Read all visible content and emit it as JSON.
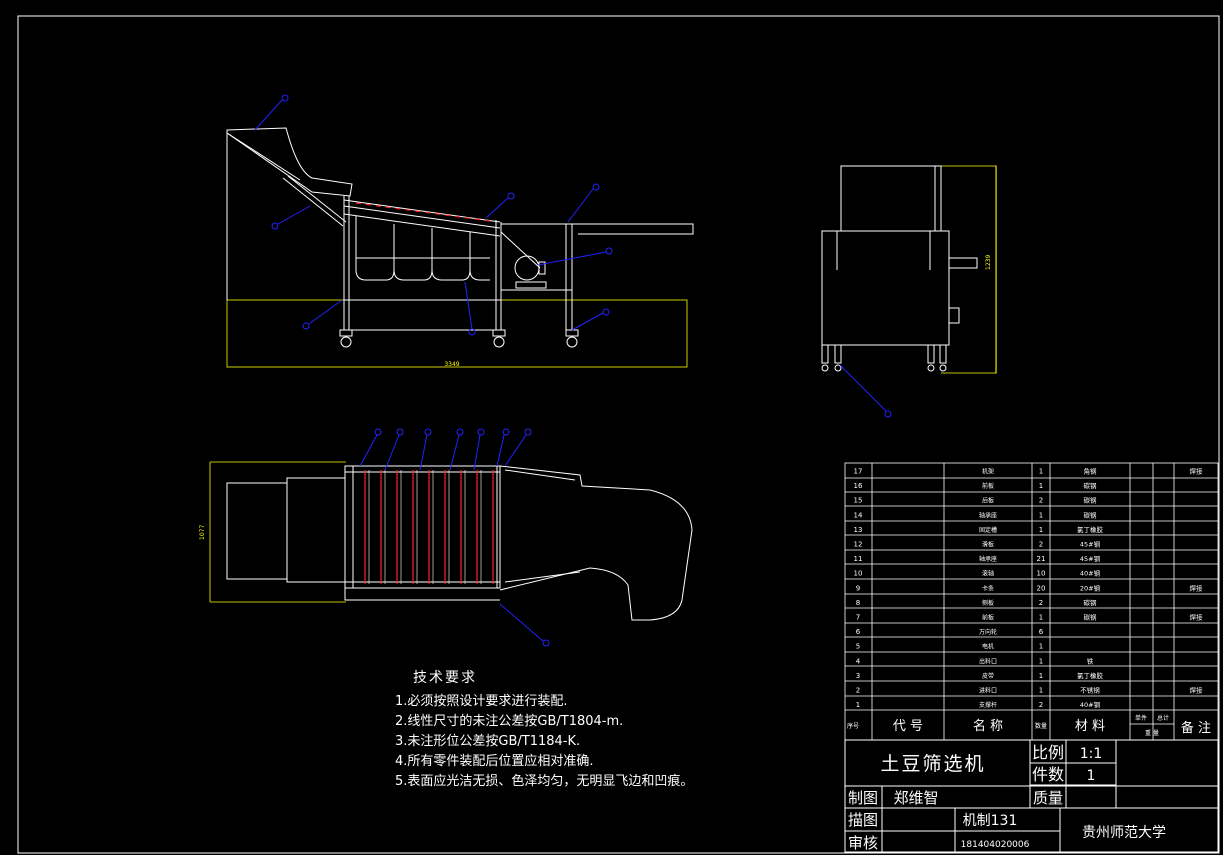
{
  "drawing": {
    "colors": {
      "background": "#000000",
      "line": "#ffffff",
      "balloon": "#2222ff",
      "screen_rod": "#ff2020",
      "dimension": "#ffff00"
    },
    "dimensions": {
      "side_length": "3349",
      "top_width": "1077",
      "end_height": "1239"
    }
  },
  "notes": {
    "title": "技术要求",
    "items": [
      "1.必须按照设计要求进行装配.",
      "2.线性尺寸的未注公差按GB/T1804-m.",
      "3.未注形位公差按GB/T1184-K.",
      "4.所有零件装配后位置应相对准确.",
      "5.表面应光洁无损、色泽均匀，无明显飞边和凹痕。"
    ]
  },
  "bom": {
    "rows": [
      {
        "no": "17",
        "name": "机架",
        "qty": "1",
        "material": "角钢",
        "note": "焊接"
      },
      {
        "no": "16",
        "name": "前板",
        "qty": "1",
        "material": "碳钢",
        "note": ""
      },
      {
        "no": "15",
        "name": "后板",
        "qty": "2",
        "material": "碳钢",
        "note": ""
      },
      {
        "no": "14",
        "name": "轴承座",
        "qty": "1",
        "material": "碳钢",
        "note": ""
      },
      {
        "no": "13",
        "name": "固定槽",
        "qty": "1",
        "material": "氯丁橡胶",
        "note": ""
      },
      {
        "no": "12",
        "name": "滑板",
        "qty": "2",
        "material": "45#钢",
        "note": ""
      },
      {
        "no": "11",
        "name": "轴承座",
        "qty": "21",
        "material": "45#钢",
        "note": ""
      },
      {
        "no": "10",
        "name": "滚轴",
        "qty": "10",
        "material": "40#钢",
        "note": ""
      },
      {
        "no": "9",
        "name": "卡条",
        "qty": "20",
        "material": "20#钢",
        "note": "焊接"
      },
      {
        "no": "8",
        "name": "侧板",
        "qty": "2",
        "material": "碳钢",
        "note": ""
      },
      {
        "no": "7",
        "name": "前板",
        "qty": "1",
        "material": "碳钢",
        "note": "焊接"
      },
      {
        "no": "6",
        "name": "万向轮",
        "qty": "6",
        "material": "",
        "note": ""
      },
      {
        "no": "5",
        "name": "电机",
        "qty": "1",
        "material": "",
        "note": ""
      },
      {
        "no": "4",
        "name": "出料口",
        "qty": "1",
        "material": "铁",
        "note": ""
      },
      {
        "no": "3",
        "name": "皮带",
        "qty": "1",
        "material": "氯丁橡胶",
        "note": ""
      },
      {
        "no": "2",
        "name": "进料口",
        "qty": "1",
        "material": "不锈钢",
        "note": "焊接"
      },
      {
        "no": "1",
        "name": "支撑杆",
        "qty": "2",
        "material": "40#钢",
        "note": ""
      }
    ],
    "header": {
      "seq": "序号",
      "code": "代 号",
      "name": "名 称",
      "qty": "数量",
      "material": "材 料",
      "unit_weight": "单件",
      "total_weight": "总计",
      "weight": "重 量",
      "remarks": "备 注"
    }
  },
  "title_block": {
    "part_name": "土豆筛选机",
    "scale_label": "比例",
    "scale_value": "1:1",
    "count_label": "件数",
    "count_value": "1",
    "drawn_label": "制图",
    "drawn_by": "郑维智",
    "mass_label": "质量",
    "traced_label": "描图",
    "class_name": "机制131",
    "checked_label": "审核",
    "student_id": "181404020006",
    "school": "贵州师范大学"
  }
}
